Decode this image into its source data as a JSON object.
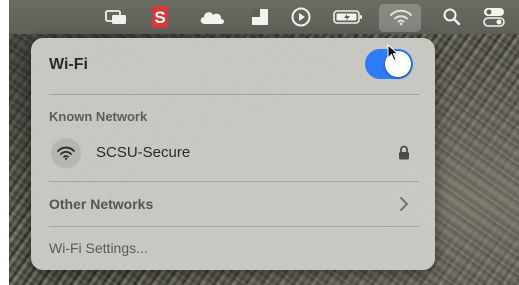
{
  "panel": {
    "title": "Wi-Fi",
    "wifi_enabled": true,
    "known_section_label": "Known Network",
    "known_networks": [
      {
        "name": "SCSU-Secure",
        "secured": true
      }
    ],
    "other_networks_label": "Other Networks",
    "settings_label": "Wi-Fi Settings..."
  },
  "menubar": {
    "icons": [
      "display-icon",
      "s-app-icon",
      "cloud-icon",
      "dropbox-icon",
      "play-icon",
      "battery-icon",
      "wifi-icon",
      "search-icon",
      "control-center-icon"
    ],
    "accent_color": "#e03b3b"
  },
  "colors": {
    "toggle_on": "#2f7bf5",
    "panel_bg": "#cecbc8"
  }
}
